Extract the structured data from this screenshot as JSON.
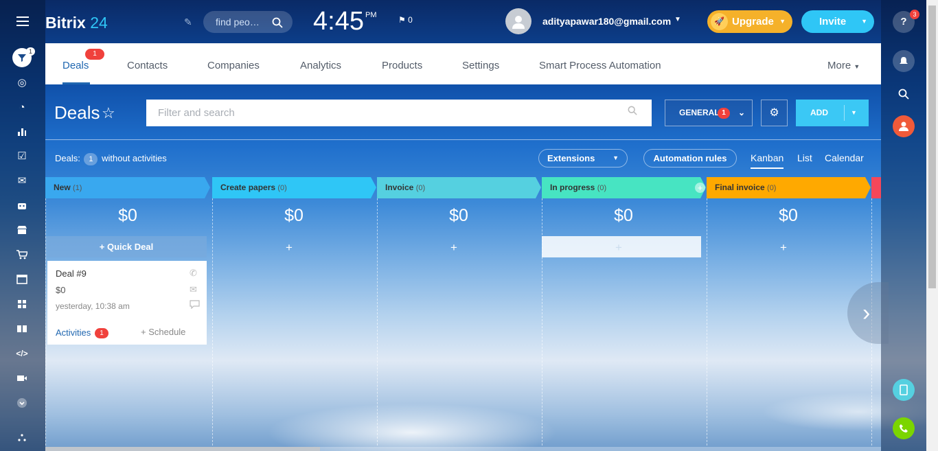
{
  "header": {
    "logo_main": "Bitrix",
    "logo_num": "24",
    "search_placeholder": "find peo…",
    "time": "4:45",
    "ampm": "PM",
    "flag_count": "0",
    "user_email": "adityapawar180@gmail.com",
    "upgrade_label": "Upgrade",
    "invite_label": "Invite"
  },
  "left_sidebar": {
    "badge": "1",
    "icons": [
      "funnel-icon",
      "target-icon",
      "clock-icon",
      "bar-chart-icon",
      "task-icon",
      "mail-icon",
      "robot-icon",
      "store-icon",
      "cart-icon",
      "window-icon",
      "apps-icon",
      "book-icon",
      "code-icon",
      "video-icon",
      "chevron-down-icon",
      "network-icon"
    ]
  },
  "right_sidebar": {
    "help_badge": "3"
  },
  "tabs": [
    {
      "label": "Deals",
      "badge": "1"
    },
    {
      "label": "Contacts"
    },
    {
      "label": "Companies"
    },
    {
      "label": "Analytics"
    },
    {
      "label": "Products"
    },
    {
      "label": "Settings"
    },
    {
      "label": "Smart Process Automation"
    },
    {
      "label": "More"
    }
  ],
  "toolbar": {
    "title": "Deals",
    "filter_placeholder": "Filter and search",
    "general_label": "GENERAL",
    "general_badge": "1",
    "add_label": "ADD"
  },
  "info": {
    "deals_prefix": "Deals:",
    "deals_count": "1",
    "deals_suffix": "without activities",
    "extensions_label": "Extensions",
    "automation_label": "Automation rules",
    "view_kanban": "Kanban",
    "view_list": "List",
    "view_calendar": "Calendar"
  },
  "kanban": {
    "columns": [
      {
        "name": "New",
        "count": "(1)",
        "amount": "$0",
        "color": "#39a8ef"
      },
      {
        "name": "Create papers",
        "count": "(0)",
        "amount": "$0",
        "color": "#2fc6f6"
      },
      {
        "name": "Invoice",
        "count": "(0)",
        "amount": "$0",
        "color": "#55d0e0"
      },
      {
        "name": "In progress",
        "count": "(0)",
        "amount": "$0",
        "color": "#47e4c2"
      },
      {
        "name": "Final invoice",
        "count": "(0)",
        "amount": "$0",
        "color": "#ffa900"
      }
    ],
    "quick_deal_label": "+ Quick Deal",
    "plus": "+",
    "card": {
      "title": "Deal #9",
      "amount": "$0",
      "date": "yesterday, 10:38 am",
      "activities_label": "Activities",
      "activities_badge": "1",
      "schedule_label": "+ Schedule"
    }
  }
}
